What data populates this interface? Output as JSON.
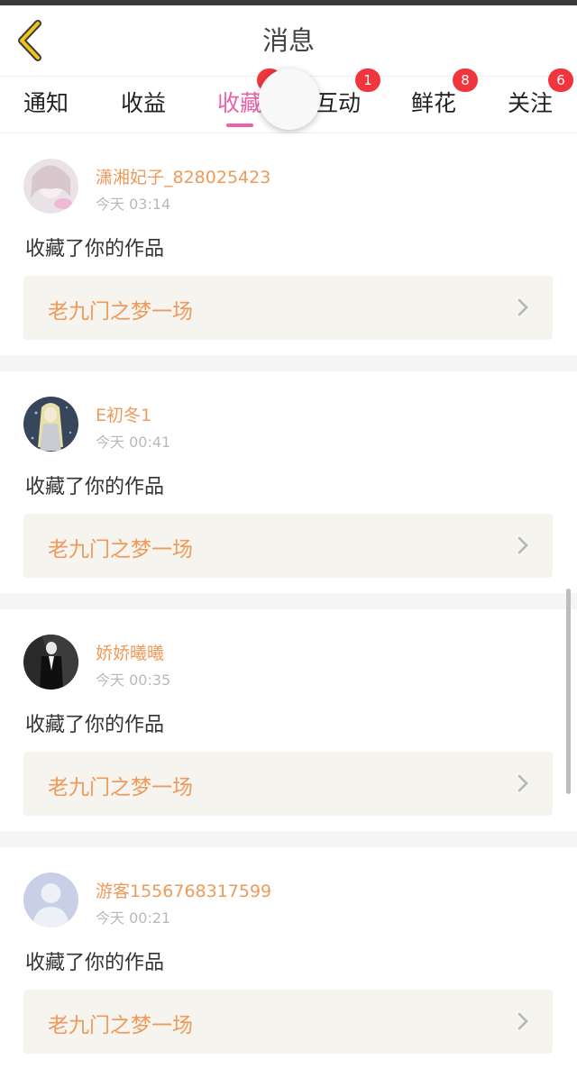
{
  "header": {
    "title": "消息",
    "back_icon": "chevron-left-icon",
    "accent": "#f0c419"
  },
  "tabs": [
    {
      "label": "通知",
      "badge": ""
    },
    {
      "label": "收益",
      "badge": ""
    },
    {
      "label": "收藏",
      "badge": "",
      "active": true
    },
    {
      "label": "互动",
      "badge": "1"
    },
    {
      "label": "鲜花",
      "badge": "8"
    },
    {
      "label": "关注",
      "badge": "6"
    }
  ],
  "colors": {
    "active_tab": "#e863a6",
    "username": "#ef9a5a",
    "badge": "#f1353f"
  },
  "items": [
    {
      "username": "潇湘妃子_828025423",
      "time": "今天 03:14",
      "action": "收藏了你的作品",
      "work_title": "老九门之梦一场"
    },
    {
      "username": "E初冬1",
      "time": "今天 00:41",
      "action": "收藏了你的作品",
      "work_title": "老九门之梦一场"
    },
    {
      "username": "娇娇曦曦",
      "time": "今天 00:35",
      "action": "收藏了你的作品",
      "work_title": "老九门之梦一场"
    },
    {
      "username": "游客1556768317599",
      "time": "今天 00:21",
      "action": "收藏了你的作品",
      "work_title": "老九门之梦一场"
    }
  ]
}
